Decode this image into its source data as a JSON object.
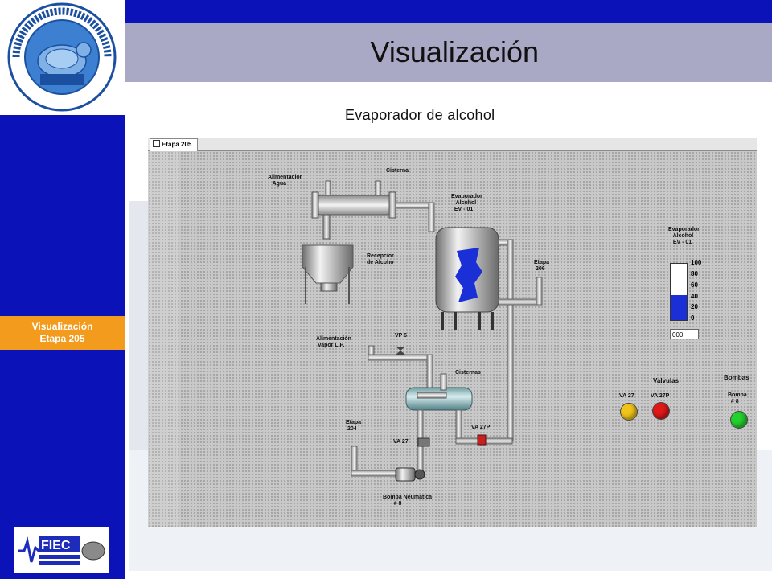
{
  "header": {
    "title": "Visualización"
  },
  "subtitle": "Evaporador de alcohol",
  "sidebar": {
    "logo": {
      "ring_text": "ESCUELA SUPERIOR POLITECNICA DEL LITORAL",
      "banner_text": "ESPOL"
    },
    "nav_item": {
      "line1": "Visualización",
      "line2": "Etapa 205"
    },
    "footer_logo": {
      "text": "FIEC"
    }
  },
  "hmi": {
    "tab_label": "Etapa 205",
    "labels": {
      "alimentacion_agua": "Alimentacior\n   Agua",
      "cisterna": "Cisterna",
      "recepcion_alcohol": "Recepcior\nde Alcoho",
      "evaporador": "Evaporador\n   Alcohol\n  EV - 01",
      "etapa_206": "Etapa\n 206",
      "alimentacion_vapor": "Alimentación\n Vapor L.P.",
      "vp6": "VP 6",
      "cisternas": "Cisternas",
      "etapa_204": "Etapa\n 204",
      "va27_pipe": "VA 27",
      "va27p_pipe": "VA 27P",
      "bomba_neumatica": "Bomba Neumatica\n       # 8",
      "panel_evaporador": "Evaporador\n   Alcohol\n   EV - 01",
      "valvulas": "Valvulas",
      "bombas": "Bombas",
      "va27_lamp": "VA 27",
      "va27p_lamp": "VA 27P",
      "bomba8_lamp": "Bomba\n  # 8"
    },
    "gauge": {
      "ticks": [
        "100",
        "80",
        "60",
        "40",
        "20",
        "0"
      ],
      "level_percent": 45,
      "readout": "000"
    },
    "lamps": {
      "va27_color": "#f0c419",
      "va27p_color": "#e01818",
      "bomba8_color": "#22d12e"
    }
  },
  "colors": {
    "sidebar": "#0b12b8",
    "title_bar": "#aaa9c5",
    "nav_highlight": "#f29b1d",
    "liquid": "#1a2fd6"
  }
}
